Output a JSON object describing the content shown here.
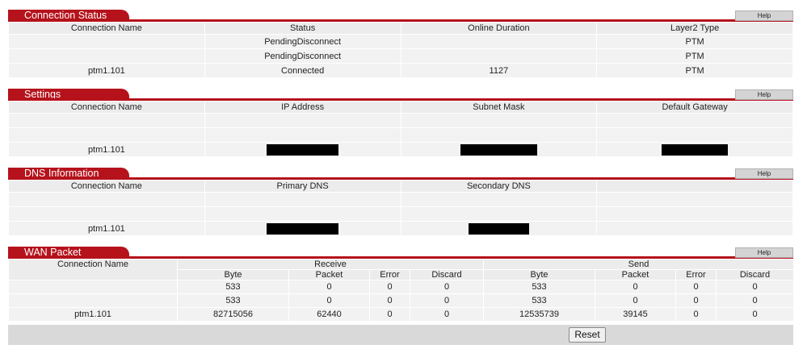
{
  "help_label": "Help",
  "connection_status": {
    "title": "Connection Status",
    "columns": [
      "Connection Name",
      "Status",
      "Online Duration",
      "Layer2 Type"
    ],
    "rows": [
      [
        "",
        "PendingDisconnect",
        "",
        "PTM"
      ],
      [
        "",
        "PendingDisconnect",
        "",
        "PTM"
      ],
      [
        "ptm1.101",
        "Connected",
        "1127",
        "PTM"
      ]
    ]
  },
  "settings": {
    "title": "Settings",
    "columns": [
      "Connection Name",
      "IP Address",
      "Subnet Mask",
      "Default Gateway"
    ],
    "rows": [
      [
        "",
        "",
        "",
        ""
      ],
      [
        "",
        "",
        "",
        ""
      ],
      [
        "ptm1.101",
        "",
        "",
        ""
      ]
    ]
  },
  "dns": {
    "title": "DNS Information",
    "columns": [
      "Connection Name",
      "Primary DNS",
      "Secondary DNS",
      ""
    ],
    "rows": [
      [
        "",
        "",
        "",
        ""
      ],
      [
        "",
        "",
        "",
        ""
      ],
      [
        "ptm1.101",
        "",
        "",
        ""
      ]
    ]
  },
  "wan": {
    "title": "WAN Packet",
    "connection_name_header": "Connection Name",
    "receive_header": "Receive",
    "send_header": "Send",
    "sub_headers": [
      "Byte",
      "Packet",
      "Error",
      "Discard",
      "Byte",
      "Packet",
      "Error",
      "Discard"
    ],
    "rows": [
      [
        "",
        "533",
        "0",
        "0",
        "0",
        "533",
        "0",
        "0",
        "0"
      ],
      [
        "",
        "533",
        "0",
        "0",
        "0",
        "533",
        "0",
        "0",
        "0"
      ],
      [
        "ptm1.101",
        "82715056",
        "62440",
        "0",
        "0",
        "12535739",
        "39145",
        "0",
        "0"
      ]
    ]
  },
  "reset_label": "Reset"
}
